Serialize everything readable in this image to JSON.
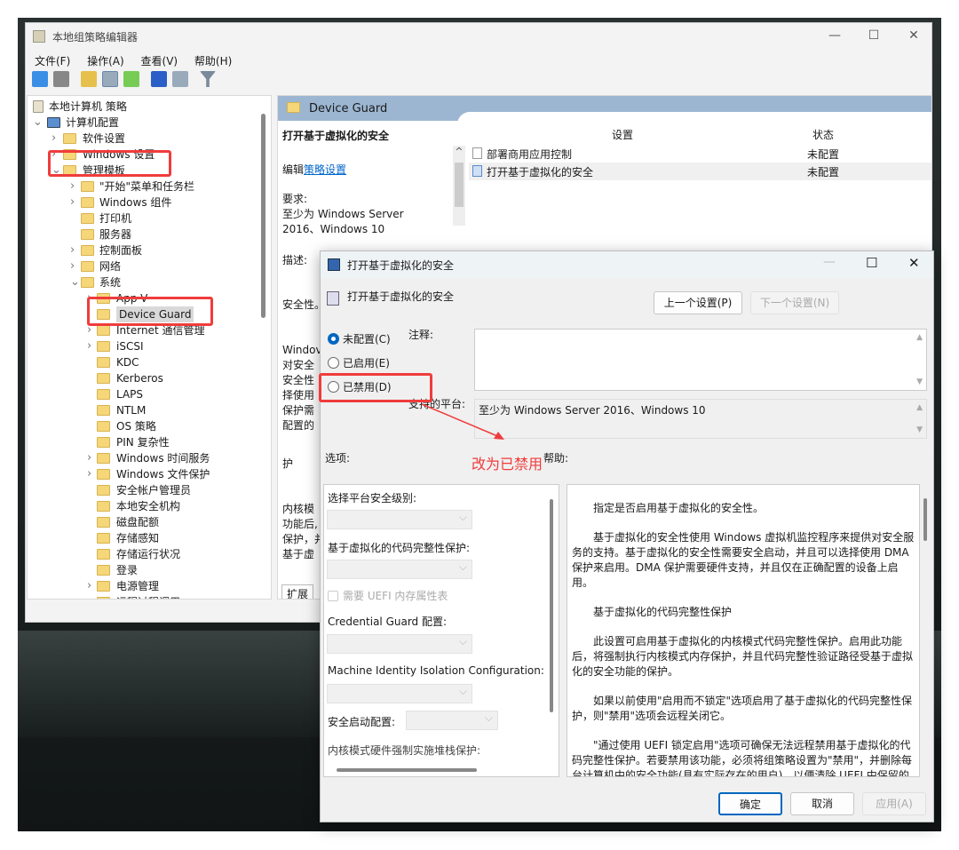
{
  "window": {
    "title": "本地组策略编辑器",
    "controls": [
      "—",
      "☐",
      "✕"
    ]
  },
  "menu": [
    "文件(F)",
    "操作(A)",
    "查看(V)",
    "帮助(H)"
  ],
  "toolbar_icons": [
    "back-icon",
    "forward-icon",
    "up-folder-icon",
    "show-hide-tree-icon",
    "export-icon",
    "help-icon",
    "properties-icon",
    "filter-icon"
  ],
  "tree": [
    {
      "label": "本地计算机 策略",
      "level": 0,
      "chevron": ""
    },
    {
      "label": "计算机配置",
      "level": 1,
      "chevron": "v"
    },
    {
      "label": "软件设置",
      "level": 2,
      "chevron": ">"
    },
    {
      "label": "Windows 设置",
      "level": 2,
      "chevron": ">"
    },
    {
      "label": "管理模板",
      "level": 2,
      "chevron": "v"
    },
    {
      "label": "\"开始\"菜单和任务栏",
      "level": 3,
      "chevron": ">"
    },
    {
      "label": "Windows 组件",
      "level": 3,
      "chevron": ">"
    },
    {
      "label": "打印机",
      "level": 3,
      "chevron": ""
    },
    {
      "label": "服务器",
      "level": 3,
      "chevron": ""
    },
    {
      "label": "控制面板",
      "level": 3,
      "chevron": ">"
    },
    {
      "label": "网络",
      "level": 3,
      "chevron": ">"
    },
    {
      "label": "系统",
      "level": 3,
      "chevron": "v"
    },
    {
      "label": "App-V",
      "level": 4,
      "chevron": ">"
    },
    {
      "label": "Device Guard",
      "level": 4,
      "chevron": "",
      "selected": true
    },
    {
      "label": "Internet 通信管理",
      "level": 4,
      "chevron": ">"
    },
    {
      "label": "iSCSI",
      "level": 4,
      "chevron": ">"
    },
    {
      "label": "KDC",
      "level": 4,
      "chevron": ""
    },
    {
      "label": "Kerberos",
      "level": 4,
      "chevron": ""
    },
    {
      "label": "LAPS",
      "level": 4,
      "chevron": ""
    },
    {
      "label": "NTLM",
      "level": 4,
      "chevron": ""
    },
    {
      "label": "OS 策略",
      "level": 4,
      "chevron": ""
    },
    {
      "label": "PIN 复杂性",
      "level": 4,
      "chevron": ""
    },
    {
      "label": "Windows 时间服务",
      "level": 4,
      "chevron": ">"
    },
    {
      "label": "Windows 文件保护",
      "level": 4,
      "chevron": ">"
    },
    {
      "label": "安全帐户管理员",
      "level": 4,
      "chevron": ""
    },
    {
      "label": "本地安全机构",
      "level": 4,
      "chevron": ""
    },
    {
      "label": "磁盘配额",
      "level": 4,
      "chevron": ""
    },
    {
      "label": "存储感知",
      "level": 4,
      "chevron": ""
    },
    {
      "label": "存储运行状况",
      "level": 4,
      "chevron": ""
    },
    {
      "label": "登录",
      "level": 4,
      "chevron": ""
    },
    {
      "label": "电源管理",
      "level": 4,
      "chevron": ">"
    },
    {
      "label": "远程过程调用",
      "level": 4,
      "chevron": ">"
    }
  ],
  "right": {
    "header": "Device Guard",
    "desc_title": "打开基于虚拟化的安全",
    "edit_prefix": "编辑",
    "edit_link": "策略设置",
    "req_label": "要求:",
    "req_text": "至少为 Windows Server 2016、Windows 10",
    "desc_label": "描述:",
    "desc_fragments": [
      "安全性。",
      "Windov",
      "对安全",
      "安全性",
      "择使用",
      "保护需",
      "配置的",
      "护",
      "内核模",
      "功能后,",
      "保护，并",
      "基于虚"
    ],
    "tab_label": "扩展",
    "columns": [
      "设置",
      "状态"
    ],
    "rows": [
      {
        "setting": "部署商用应用控制",
        "status": "未配置"
      },
      {
        "setting": "打开基于虚拟化的安全",
        "status": "未配置"
      }
    ]
  },
  "dialog": {
    "title": "打开基于虚拟化的安全",
    "setting_name": "打开基于虚拟化的安全",
    "prev": "上一个设置(P)",
    "next": "下一个设置(N)",
    "radios": [
      {
        "label": "未配置(C)",
        "checked": true
      },
      {
        "label": "已启用(E)",
        "checked": false
      },
      {
        "label": "已禁用(D)",
        "checked": false
      }
    ],
    "comment_label": "注释:",
    "platform_label": "支持的平台:",
    "platform_text": "至少为 Windows Server 2016、Windows 10",
    "options_label": "选项:",
    "help_label": "帮助:",
    "options": {
      "platform_level": "选择平台安全级别:",
      "vbs_code": "基于虚拟化的代码完整性保护:",
      "uefi_mat": "需要 UEFI 内存属性表",
      "credential_guard": "Credential Guard 配置:",
      "machine_identity": "Machine Identity Isolation Configuration:",
      "secure_launch": "安全启动配置:",
      "kernel_stack": "内核模式硬件强制实施堆栈保护:"
    },
    "help": [
      "指定是否启用基于虚拟化的安全性。",
      "基于虚拟化的安全性使用 Windows 虚拟机监控程序来提供对安全服务的支持。基于虚拟化的安全性需要安全启动，并且可以选择使用 DMA 保护来启用。DMA 保护需要硬件支持，并且仅在正确配置的设备上启用。",
      "基于虚拟化的代码完整性保护",
      "此设置可启用基于虚拟化的内核模式代码完整性保护。启用此功能后，将强制执行内核模式内存保护，并且代码完整性验证路径受基于虚拟化的安全功能的保护。",
      "如果以前使用\"启用而不锁定\"选项启用了基于虚拟化的代码完整性保护，则\"禁用\"选项会远程关闭它。",
      "\"通过使用 UEFI 锁定启用\"选项可确保无法远程禁用基于虚拟化的代码完整性保护。若要禁用该功能，必须将组策略设置为\"禁用\"，并删除每台计算机中的安全功能(具有实际存在的用户)，以便清除 UEFI 中保留的配置。"
    ],
    "ok": "确定",
    "cancel": "取消",
    "apply": "应用(A)"
  },
  "annotation": {
    "text": "改为已禁用",
    "color": "#f03c3c"
  }
}
